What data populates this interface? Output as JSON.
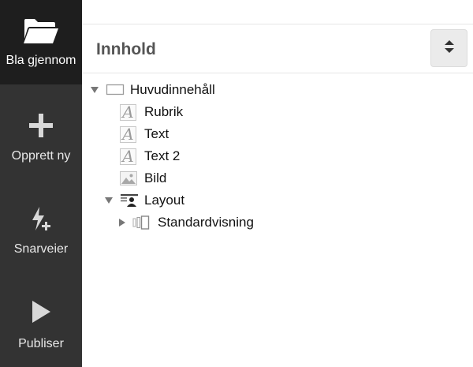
{
  "sidebar": {
    "items": [
      {
        "label": "Bla gjennom",
        "icon": "folder-open-icon",
        "active": true
      },
      {
        "label": "Opprett ny",
        "icon": "plus-icon"
      },
      {
        "label": "Snarveier",
        "icon": "lightning-plus-icon"
      },
      {
        "label": "Publiser",
        "icon": "play-icon"
      }
    ]
  },
  "panel": {
    "title": "Innhold",
    "sort_icon": "sort-updown-icon"
  },
  "tree": {
    "root": {
      "label": "Huvudinnehåll",
      "icon": "region-frame-icon",
      "expanded": true
    },
    "children": [
      {
        "label": "Rubrik",
        "icon": "text-part-icon"
      },
      {
        "label": "Text",
        "icon": "text-part-icon"
      },
      {
        "label": "Text 2",
        "icon": "text-part-icon"
      },
      {
        "label": "Bild",
        "icon": "image-part-icon"
      }
    ],
    "layout": {
      "label": "Layout",
      "icon": "layout-icon",
      "expanded": true
    },
    "layout_child": {
      "label": "Standardvisning",
      "icon": "view-variant-icon",
      "expanded": false
    }
  },
  "colors": {
    "sidebar_bg": "#333333",
    "sidebar_active_bg": "#1e1e1e",
    "header_text": "#555555",
    "sort_button_bg": "#ebebeb"
  }
}
